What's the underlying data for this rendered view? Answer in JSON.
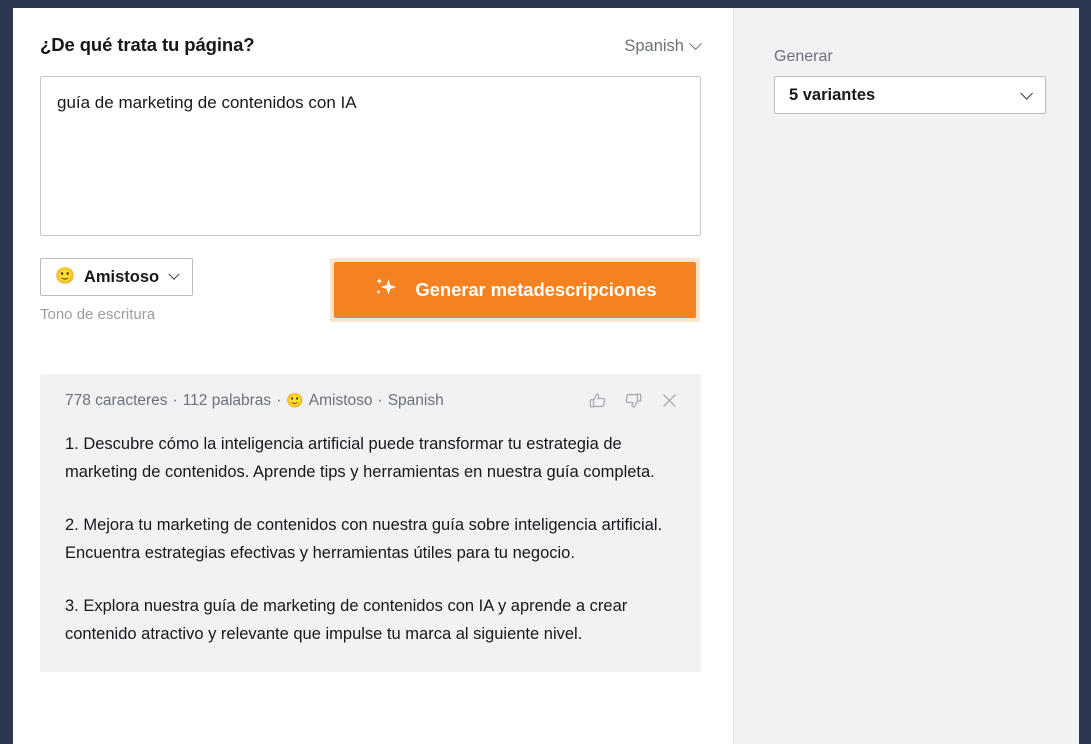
{
  "theme": {
    "chrome": "#2b3850",
    "accent": "#f58220",
    "accent_ring": "#fbe5cd",
    "sidebar_bg": "#f1f2f4",
    "card_bg": "#f1f2f3"
  },
  "prompt": {
    "title": "¿De qué trata tu página?",
    "language": "Spanish",
    "language_chevron_icon": "chevron-down-icon",
    "textarea_value": "guía de marketing de contenidos con IA",
    "textarea_placeholder": ""
  },
  "controls": {
    "tone_emoji": "🙂",
    "tone_value": "Amistoso",
    "tone_chevron_icon": "chevron-down-icon",
    "tone_caption": "Tono de escritura",
    "generate_icon": "sparkle-icon",
    "generate_label": "Generar metadescripciones"
  },
  "result": {
    "char_count": "778 caracteres",
    "separator_1": "·",
    "word_count": "112 palabras",
    "separator_2": "·",
    "tone_emoji": "🙂",
    "tone": "Amistoso",
    "separator_3": "·",
    "language": "Spanish",
    "actions": {
      "thumbs_up_icon": "thumbs-up-icon",
      "thumbs_down_icon": "thumbs-down-icon",
      "close_icon": "close-icon"
    },
    "items": [
      "1. Descubre cómo la inteligencia artificial puede transformar tu estrategia de marketing de contenidos. Aprende tips y herramientas en nuestra guía completa.",
      "2. Mejora tu marketing de contenidos con nuestra guía sobre inteligencia artificial. Encuentra estrategias efectivas y herramientas útiles para tu negocio.",
      "3. Explora nuestra guía de marketing de contenidos con IA y aprende a crear contenido atractivo y relevante que impulse tu marca al siguiente nivel."
    ]
  },
  "sidebar": {
    "generate_label": "Generar",
    "variants_value": "5 variantes",
    "variants_chevron_icon": "chevron-down-icon"
  }
}
